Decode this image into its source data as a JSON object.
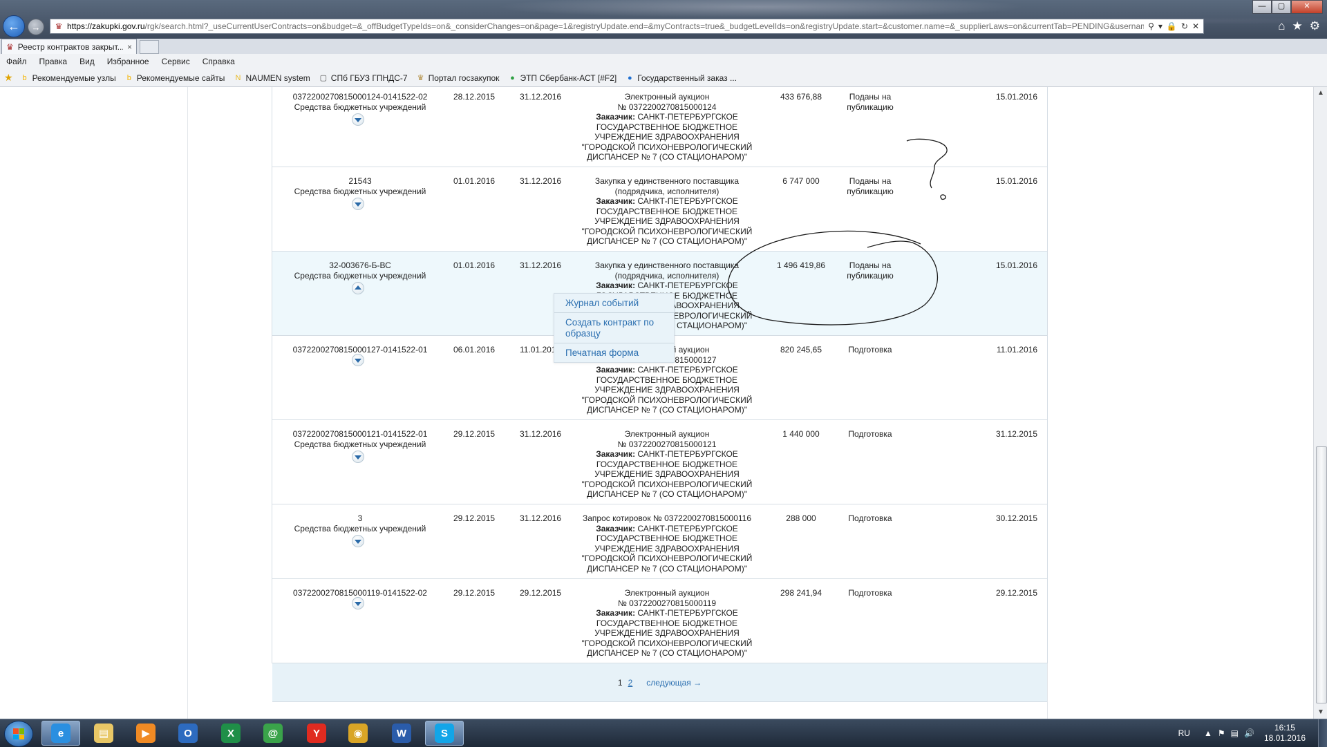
{
  "browser": {
    "url_host": "https://zakupki.gov.ru",
    "url_path": "/rgk/search.html?_useCurrentUserContracts=on&budget=&_offBudgetTypeIds=on&_considerChanges=on&page=1&registryUpdate.end=&myContracts=true&_budgetLevelIds=on&registryUpdate.start=&customer.name=&_supplierLaws=on&currentTab=PENDING&usernames=&_intere",
    "tab_title": "Реестр контрактов закрыт...",
    "tab_close": "×",
    "menu": [
      "Файл",
      "Правка",
      "Вид",
      "Избранное",
      "Сервис",
      "Справка"
    ],
    "favorites": [
      {
        "label": "Рекомендуемые узлы",
        "icon": "bing-icon",
        "color": "#f4b400"
      },
      {
        "label": "Рекомендуемые сайты",
        "icon": "bing-icon",
        "color": "#f4b400"
      },
      {
        "label": "NAUMEN system",
        "icon": "naumen-icon",
        "color": "#e8b923"
      },
      {
        "label": "СПб ГБУЗ ГПНДС-7",
        "icon": "page-icon",
        "color": "#ffffff"
      },
      {
        "label": "Портал госзакупок",
        "icon": "emblem-icon",
        "color": "#b08a3a"
      },
      {
        "label": "ЭТП Сбербанк-АСТ [#F2]",
        "icon": "sberbank-icon",
        "color": "#2ea043"
      },
      {
        "label": "Государственный заказ ...",
        "icon": "globe-icon",
        "color": "#1f6fd1"
      }
    ]
  },
  "rows": [
    {
      "number": "0372200270815000124-0141522-02",
      "source": "Средства бюджетных учреждений",
      "start": "28.12.2015",
      "end": "31.12.2016",
      "proc_line1": "Электронный аукцион",
      "proc_line2": "№ 0372200270815000124",
      "customer_label": "Заказчик:",
      "customer": "САНКТ-ПЕТЕРБУРГСКОЕ ГОСУДАРСТВЕННОЕ БЮДЖЕТНОЕ УЧРЕЖДЕНИЕ ЗДРАВООХРАНЕНИЯ \"ГОРОДСКОЙ ПСИХОНЕВРОЛОГИЧЕСКИЙ ДИСПАНСЕР № 7 (СО СТАЦИОНАРОМ)\"",
      "sum": "433 676,88",
      "status": "Поданы на публикацию",
      "date": "15.01.2016",
      "toggle": "down"
    },
    {
      "number": "21543",
      "source": "Средства бюджетных учреждений",
      "start": "01.01.2016",
      "end": "31.12.2016",
      "proc_line1": "Закупка у единственного поставщика",
      "proc_line2": "(подрядчика, исполнителя)",
      "customer_label": "Заказчик:",
      "customer": "САНКТ-ПЕТЕРБУРГСКОЕ ГОСУДАРСТВЕННОЕ БЮДЖЕТНОЕ УЧРЕЖДЕНИЕ ЗДРАВООХРАНЕНИЯ \"ГОРОДСКОЙ ПСИХОНЕВРОЛОГИЧЕСКИЙ ДИСПАНСЕР № 7 (СО СТАЦИОНАРОМ)\"",
      "sum": "6 747 000",
      "status": "Поданы на публикацию",
      "date": "15.01.2016",
      "toggle": "down"
    },
    {
      "number": "32-003676-Б-ВС",
      "source": "Средства бюджетных учреждений",
      "start": "01.01.2016",
      "end": "31.12.2016",
      "proc_line1": "Закупка у единственного поставщика",
      "proc_line2": "(подрядчика, исполнителя)",
      "customer_label": "Заказчик:",
      "customer": "САНКТ-ПЕТЕРБУРГСКОЕ ГОСУДАРСТВЕННОЕ БЮДЖЕТНОЕ УЧРЕЖДЕНИЕ ЗДРАВООХРАНЕНИЯ \"ГОРОДСКОЙ ПСИХОНЕВРОЛОГИЧЕСКИЙ ДИСПАНСЕР № 7 (СО СТАЦИОНАРОМ)\"",
      "sum": "1 496 419,86",
      "status": "Поданы на публикацию",
      "date": "15.01.2016",
      "toggle": "up"
    },
    {
      "number": "0372200270815000127-0141522-01",
      "source": "",
      "start": "06.01.2016",
      "end": "11.01.2016",
      "proc_line1": "Электронный аукцион",
      "proc_line2": "№ 0372200270815000127",
      "customer_label": "Заказчик:",
      "customer": "САНКТ-ПЕТЕРБУРГСКОЕ ГОСУДАРСТВЕННОЕ БЮДЖЕТНОЕ УЧРЕЖДЕНИЕ ЗДРАВООХРАНЕНИЯ \"ГОРОДСКОЙ ПСИХОНЕВРОЛОГИЧЕСКИЙ ДИСПАНСЕР № 7 (СО СТАЦИОНАРОМ)\"",
      "sum": "820 245,65",
      "status": "Подготовка",
      "date": "11.01.2016",
      "toggle": "down"
    },
    {
      "number": "0372200270815000121-0141522-01",
      "source": "Средства бюджетных учреждений",
      "start": "29.12.2015",
      "end": "31.12.2016",
      "proc_line1": "Электронный аукцион",
      "proc_line2": "№ 0372200270815000121",
      "customer_label": "Заказчик:",
      "customer": "САНКТ-ПЕТЕРБУРГСКОЕ ГОСУДАРСТВЕННОЕ БЮДЖЕТНОЕ УЧРЕЖДЕНИЕ ЗДРАВООХРАНЕНИЯ \"ГОРОДСКОЙ ПСИХОНЕВРОЛОГИЧЕСКИЙ ДИСПАНСЕР № 7 (СО СТАЦИОНАРОМ)\"",
      "sum": "1 440 000",
      "status": "Подготовка",
      "date": "31.12.2015",
      "toggle": "down"
    },
    {
      "number": "3",
      "source": "Средства бюджетных учреждений",
      "start": "29.12.2015",
      "end": "31.12.2016",
      "proc_line1": "Запрос котировок  № 0372200270815000116",
      "proc_line2": "",
      "customer_label": "Заказчик:",
      "customer": "САНКТ-ПЕТЕРБУРГСКОЕ ГОСУДАРСТВЕННОЕ БЮДЖЕТНОЕ УЧРЕЖДЕНИЕ ЗДРАВООХРАНЕНИЯ \"ГОРОДСКОЙ ПСИХОНЕВРОЛОГИЧЕСКИЙ ДИСПАНСЕР № 7 (СО СТАЦИОНАРОМ)\"",
      "sum": "288 000",
      "status": "Подготовка",
      "date": "30.12.2015",
      "toggle": "down"
    },
    {
      "number": "0372200270815000119-0141522-02",
      "source": "",
      "start": "29.12.2015",
      "end": "29.12.2015",
      "proc_line1": "Электронный аукцион",
      "proc_line2": "№ 0372200270815000119",
      "customer_label": "Заказчик:",
      "customer": "САНКТ-ПЕТЕРБУРГСКОЕ ГОСУДАРСТВЕННОЕ БЮДЖЕТНОЕ УЧРЕЖДЕНИЕ ЗДРАВООХРАНЕНИЯ \"ГОРОДСКОЙ ПСИХОНЕВРОЛОГИЧЕСКИЙ ДИСПАНСЕР № 7 (СО СТАЦИОНАРОМ)\"",
      "sum": "298 241,94",
      "status": "Подготовка",
      "date": "29.12.2015",
      "toggle": "down"
    }
  ],
  "context_menu": [
    "Журнал событий",
    "Создать контракт по образцу",
    "Печатная форма"
  ],
  "pager": {
    "pages": [
      "1",
      "2"
    ],
    "current": "1",
    "next": "следующая →"
  },
  "taskbar": {
    "apps": [
      {
        "name": "ie",
        "icon": "ie-icon",
        "color": "#2a8fe0",
        "glyph": "e",
        "active": true
      },
      {
        "name": "explorer",
        "icon": "folder-icon",
        "color": "#e8c766",
        "glyph": "▤",
        "active": false
      },
      {
        "name": "media-player",
        "icon": "play-icon",
        "color": "#f08a24",
        "glyph": "▶",
        "active": false
      },
      {
        "name": "outlook",
        "icon": "outlook-icon",
        "color": "#2d6bbf",
        "glyph": "O",
        "active": false
      },
      {
        "name": "excel",
        "icon": "excel-icon",
        "color": "#1f8f48",
        "glyph": "X",
        "active": false
      },
      {
        "name": "mail-agent",
        "icon": "mail-agent-icon",
        "color": "#3aa34a",
        "glyph": "@",
        "active": false
      },
      {
        "name": "yandex",
        "icon": "yandex-icon",
        "color": "#e02b20",
        "glyph": "Y",
        "active": false
      },
      {
        "name": "chrome",
        "icon": "chrome-icon",
        "color": "#d9a526",
        "glyph": "◉",
        "active": false
      },
      {
        "name": "word",
        "icon": "word-icon",
        "color": "#2a5caa",
        "glyph": "W",
        "active": false
      },
      {
        "name": "skype",
        "icon": "skype-icon",
        "color": "#12a5e8",
        "glyph": "S",
        "active": true
      }
    ],
    "lang": "RU",
    "time": "16:15",
    "date": "18.01.2016"
  },
  "colors": {
    "link": "#2b6fb0",
    "row_highlight": "#eef8fc",
    "pager_bg": "#e7f2f8"
  }
}
